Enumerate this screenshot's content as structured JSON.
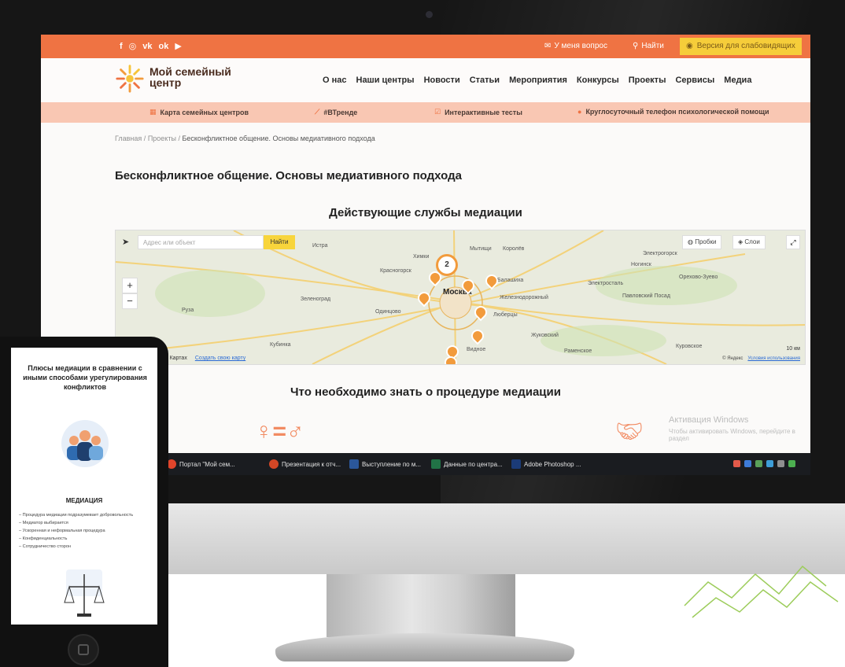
{
  "social_icons": [
    "f",
    "◎",
    "vk",
    "ok",
    "▶"
  ],
  "topbar": {
    "question": "У меня вопрос",
    "find": "Найти",
    "vision": "Версия для слабовидящих"
  },
  "logo": {
    "text": "Мой семейный центр"
  },
  "nav": [
    "О нас",
    "Наши центры",
    "Новости",
    "Статьи",
    "Мероприятия",
    "Конкурсы",
    "Проекты",
    "Сервисы",
    "Медиа"
  ],
  "subbar": {
    "map_link": "Карта семейных центров",
    "trends": "#ВТренде",
    "tests": "Интерактивные тесты",
    "hotline": "Круглосуточный телефон психологической помощи"
  },
  "breadcrumb": {
    "home": "Главная",
    "sep": "/",
    "projects": "Проекты",
    "current": "Бесконфликтное общение. Основы медиативного подхода"
  },
  "page_title": "Бесконфликтное общение. Основы медиативного подхода",
  "services_title": "Действующие службы медиации",
  "map": {
    "search_placeholder": "Адрес или объект",
    "find_button": "Найти",
    "traffic": "Пробки",
    "layers": "Слои",
    "open_in_yandex": "Открыть в Яндекс Картах",
    "create_map": "Создать свою карту",
    "scale": "10 км",
    "copyright": "© Яндекс",
    "terms": "Условия использования",
    "cluster_count": "2",
    "labels": {
      "moscow": "Москва",
      "khimki": "Химки",
      "mytishchi": "Мытищи",
      "korolev": "Королёв",
      "balashikha": "Балашиха",
      "lyubertsy": "Люберцы",
      "odintsovo": "Одинцово",
      "krasnogorsk": "Красногорск",
      "zelenograd": "Зеленоград",
      "zhukovsky": "Жуковский",
      "vidnoe": "Видное",
      "noginsk": "Ногинск",
      "elektrostal": "Электросталь",
      "orekhovo": "Орехово-Зуево",
      "ruza": "Руза",
      "istra": "Истра",
      "ramenskoe": "Раменское",
      "kubinka": "Кубинка",
      "pavlovsky_posad": "Павловский Посад",
      "kurovskoe": "Куровское",
      "elektrogorsk": "Электрогорск",
      "zheleznodorozhny": "Железнодорожный"
    }
  },
  "know_title": "Что необходимо знать о процедуре медиации",
  "activation": {
    "line1": "Активация Windows",
    "line2": "Чтобы активировать Windows, перейдите в раздел"
  },
  "taskbar": [
    {
      "label": "Портал \"Мой сем...",
      "color": "#e0452b"
    },
    {
      "label": "Презентация к отч...",
      "color": "#d24726"
    },
    {
      "label": "Выступление по м...",
      "color": "#2b579a"
    },
    {
      "label": "Данные по центра...",
      "color": "#217346"
    },
    {
      "label": "Adobe Photoshop ...",
      "color": "#1b3b78"
    }
  ],
  "tablet": {
    "title": "Плюсы медиации в сравнении с иными способами урегулирования конфликтов",
    "mediation_label": "МЕДИАЦИЯ",
    "items": [
      "– Процедура медиации подразумевает добровольность",
      "– Медиатор выбирается",
      "– Ускоренная и неформальная процедура",
      "– Конфиденциальность",
      "– Сотрудничество сторон"
    ]
  },
  "colors": {
    "topbar": "#ef7343",
    "subbar": "#f9c7b3",
    "vision_button": "#f6cd3a",
    "pin": "#f29b3c"
  }
}
